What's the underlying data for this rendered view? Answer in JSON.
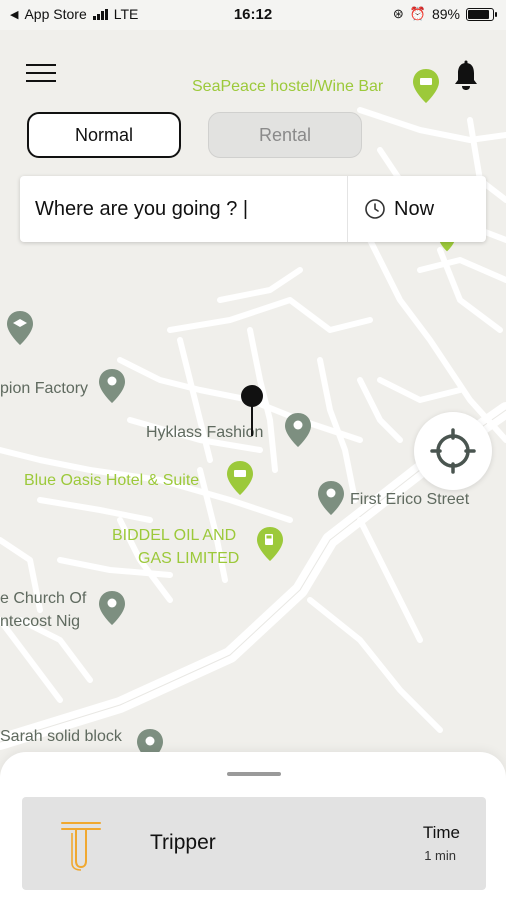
{
  "status_bar": {
    "back_app": "App Store",
    "network": "LTE",
    "time": "16:12",
    "battery": "89%"
  },
  "modes": {
    "normal": "Normal",
    "rental": "Rental"
  },
  "search": {
    "text": "Where are you going ? |",
    "time_label": "Now"
  },
  "map": {
    "pois": [
      {
        "label": "SeaPeace hostel/Wine Bar",
        "color": "green",
        "icon": "hotel-icon"
      },
      {
        "label": "pion Factory",
        "color": "gray",
        "icon": "place-pin-icon"
      },
      {
        "label": "Hyklass Fashion",
        "color": "gray",
        "icon": "place-pin-icon"
      },
      {
        "label": "Blue Oasis Hotel & Suite",
        "color": "green",
        "icon": "hotel-icon"
      },
      {
        "label": "First Erico Street",
        "color": "gray",
        "icon": "place-pin-icon"
      },
      {
        "label": "BIDDEL OIL AND",
        "color": "green",
        "icon": "gas-station-icon"
      },
      {
        "label": "GAS LIMITED",
        "color": "green",
        "icon": "gas-station-icon"
      },
      {
        "label": "e Church Of",
        "color": "gray",
        "icon": "place-pin-icon"
      },
      {
        "label": "ntecost Nig",
        "color": "gray",
        "icon": "place-pin-icon"
      },
      {
        "label": "Sarah solid block",
        "color": "gray",
        "icon": "place-pin-icon"
      }
    ]
  },
  "ride": {
    "name": "Tripper",
    "time_label": "Time",
    "time_value": "1 min"
  },
  "colors": {
    "poi_green": "#9cc93a",
    "poi_gray": "#5f6a5f",
    "map_bg": "#f0efeb",
    "ride_icon": "#f0a830"
  }
}
